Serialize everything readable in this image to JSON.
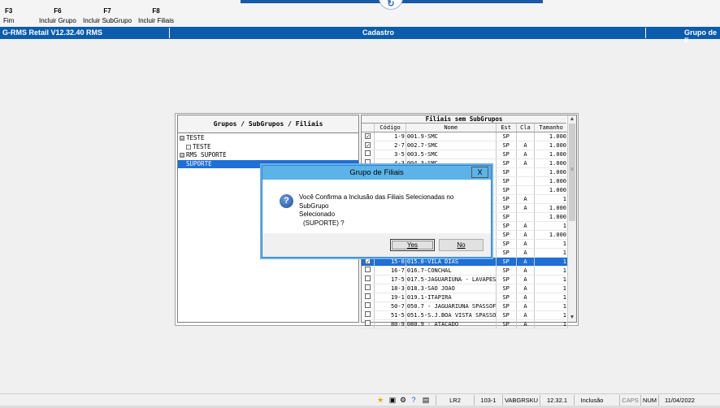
{
  "toolbar": {
    "keys": [
      {
        "key": "F3",
        "label": "Fim"
      },
      {
        "key": "F6",
        "label": "Incluir Grupo"
      },
      {
        "key": "F7",
        "label": "Incluir SubGrupo"
      },
      {
        "key": "F8",
        "label": "Incluir Filiais"
      }
    ]
  },
  "titlebar": {
    "app": "G-RMS Retail V12.32.40 RMS",
    "module": "Cadastro",
    "screen": "Grupo de F"
  },
  "left_panel": {
    "header": "Grupos / SubGrupos / Filiais",
    "tree": [
      {
        "label": "TESTE",
        "toggle": "⊟"
      },
      {
        "label": "TESTE",
        "toggle": "☐"
      },
      {
        "label": "RMS SUPORTE",
        "toggle": "⊟"
      },
      {
        "label": "SUPORTE",
        "toggle": ""
      }
    ]
  },
  "right_panel": {
    "header": "Filiais sem SubGrupos",
    "columns": [
      "",
      "Código",
      "Nome",
      "Est",
      "Cla",
      "Tamanho"
    ],
    "rows": [
      {
        "check": "✓",
        "codigo": "1-9",
        "nome": "001.9-SMC",
        "est": "SP",
        "cla": "",
        "tam": "1.000"
      },
      {
        "check": "✓",
        "codigo": "2-7",
        "nome": "002.7-SMC",
        "est": "SP",
        "cla": "A",
        "tam": "1.000"
      },
      {
        "check": "",
        "codigo": "3-5",
        "nome": "003.5-SMC",
        "est": "SP",
        "cla": "A",
        "tam": "1.000"
      },
      {
        "check": "",
        "codigo": "4-3",
        "nome": "004.3-SMC",
        "est": "SP",
        "cla": "A",
        "tam": "1.000"
      },
      {
        "check": "",
        "codigo": "",
        "nome": "",
        "est": "SP",
        "cla": "",
        "tam": "1.000"
      },
      {
        "check": "",
        "codigo": "",
        "nome": "",
        "est": "SP",
        "cla": "",
        "tam": "1.000"
      },
      {
        "check": "",
        "codigo": "",
        "nome": "",
        "est": "SP",
        "cla": "",
        "tam": "1.000"
      },
      {
        "check": "",
        "codigo": "",
        "nome": "",
        "est": "SP",
        "cla": "A",
        "tam": "1"
      },
      {
        "check": "",
        "codigo": "",
        "nome": "",
        "est": "SP",
        "cla": "A",
        "tam": "1.000"
      },
      {
        "check": "",
        "codigo": "",
        "nome": "",
        "est": "SP",
        "cla": "",
        "tam": "1.000"
      },
      {
        "check": "",
        "codigo": "",
        "nome": "",
        "est": "SP",
        "cla": "A",
        "tam": "1"
      },
      {
        "check": "",
        "codigo": "",
        "nome": "",
        "est": "SP",
        "cla": "A",
        "tam": "1.000"
      },
      {
        "check": "",
        "codigo": "",
        "nome": "",
        "est": "SP",
        "cla": "A",
        "tam": "1"
      },
      {
        "check": "",
        "codigo": "",
        "nome": "",
        "est": "SP",
        "cla": "A",
        "tam": "1"
      },
      {
        "check": "✓",
        "codigo": "15-0",
        "nome": "015.0-VILA DIAS",
        "est": "SP",
        "cla": "A",
        "tam": "1",
        "selected": true
      },
      {
        "check": "",
        "codigo": "16-7",
        "nome": "016.7-CONCHAL",
        "est": "SP",
        "cla": "A",
        "tam": "1"
      },
      {
        "check": "",
        "codigo": "17-5",
        "nome": "017.5-JAGUARIUNA - LAVAPES",
        "est": "SP",
        "cla": "A",
        "tam": "1"
      },
      {
        "check": "",
        "codigo": "18-3",
        "nome": "018.3-SAO JOAO",
        "est": "SP",
        "cla": "A",
        "tam": "1"
      },
      {
        "check": "",
        "codigo": "19-1",
        "nome": "019.1-ITAPIRA",
        "est": "SP",
        "cla": "A",
        "tam": "1"
      },
      {
        "check": "",
        "codigo": "50-7",
        "nome": "050.7 - JAGUARIUNA SPASSOFA",
        "est": "SP",
        "cla": "A",
        "tam": "1"
      },
      {
        "check": "",
        "codigo": "51-5",
        "nome": "051.5-S.J.BOA VISTA SPASSOFA",
        "est": "SP",
        "cla": "A",
        "tam": "1"
      },
      {
        "check": "",
        "codigo": "80-9",
        "nome": "080.9 - ATACADO",
        "est": "SP",
        "cla": "A",
        "tam": "1"
      }
    ]
  },
  "dialog": {
    "title": "Grupo de Filiais",
    "close": "X",
    "icon": "question-icon",
    "message_line1": "Você Confirma a Inclusão das Filiais Selecionadas no SubGrupo",
    "message_line2": "Selecionado",
    "message_line3": "(SUPORTE) ?",
    "yes": "Yes",
    "no": "No"
  },
  "statusbar": {
    "user": "LR2",
    "code": "103-1",
    "login": "VABGRSKU",
    "version": "12.32.1",
    "mode": "Inclusão",
    "caps": "CAPS",
    "num": "NUM",
    "date": "11/04/2022"
  },
  "colors": {
    "titlebar": "#0b5cad",
    "selection": "#1e6fd6",
    "dialog_title": "#5cb3e8",
    "arrow": "#e01010"
  }
}
